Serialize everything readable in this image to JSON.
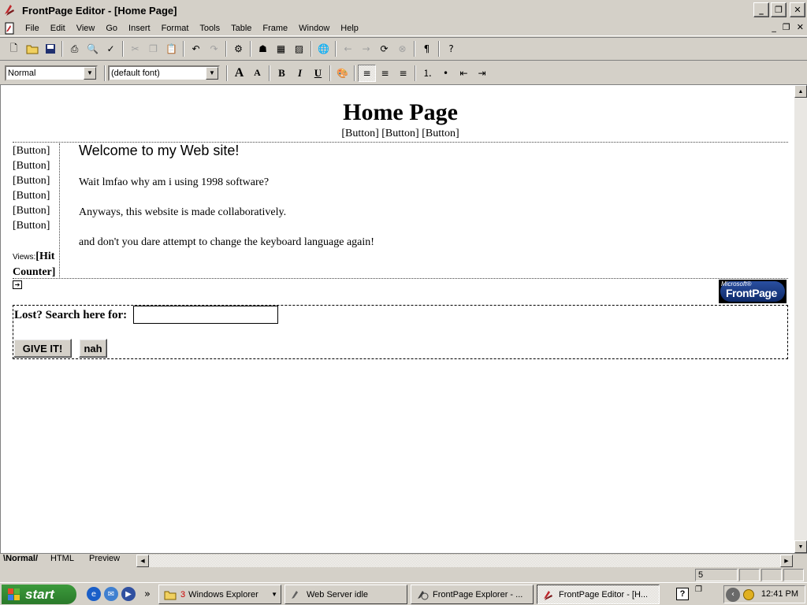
{
  "window": {
    "title": "FrontPage Editor - [Home Page]",
    "minimize": "_",
    "maximize": "❐",
    "close": "✕"
  },
  "menu": [
    "File",
    "Edit",
    "View",
    "Go",
    "Insert",
    "Format",
    "Tools",
    "Table",
    "Frame",
    "Window",
    "Help"
  ],
  "mdi": {
    "minimize": "_",
    "restore": "❐",
    "close": "✕"
  },
  "toolbar2": {
    "style_value": "Normal",
    "font_value": "(default font)",
    "bold": "B",
    "italic": "I",
    "underline": "U"
  },
  "page": {
    "title": "Home Page",
    "top_nav": "[Button] [Button] [Button]",
    "left_nav": [
      "[Button]",
      "[Button]",
      "[Button]",
      "[Button]",
      "[Button]",
      "[Button]"
    ],
    "views_label": "Views:",
    "hit_counter_line1": "[Hit",
    "hit_counter_line2": "Counter]",
    "welcome": "Welcome to my Web site!",
    "paragraphs": [
      "Wait lmfao why am i using 1998 software?",
      "Anyways, this website is made collaboratively.",
      "and don't you dare attempt to change the keyboard language again!"
    ],
    "logo_small": "Microsoft®",
    "logo_big": "FrontPage",
    "search_label": "Lost? Search here for:",
    "search_value": "",
    "submit_label": "GIVE IT!",
    "reset_label": "nah"
  },
  "view_tabs": [
    "Normal",
    "HTML",
    "Preview"
  ],
  "status": {
    "load_time": "5 seconds"
  },
  "taskbar": {
    "start": "start",
    "tasks": [
      {
        "label": "Windows Explorer",
        "count": "3"
      },
      {
        "label": "Web Server idle"
      },
      {
        "label": "FrontPage Explorer - ..."
      },
      {
        "label": "FrontPage Editor - [H..."
      }
    ],
    "clock": "12:41 PM"
  }
}
